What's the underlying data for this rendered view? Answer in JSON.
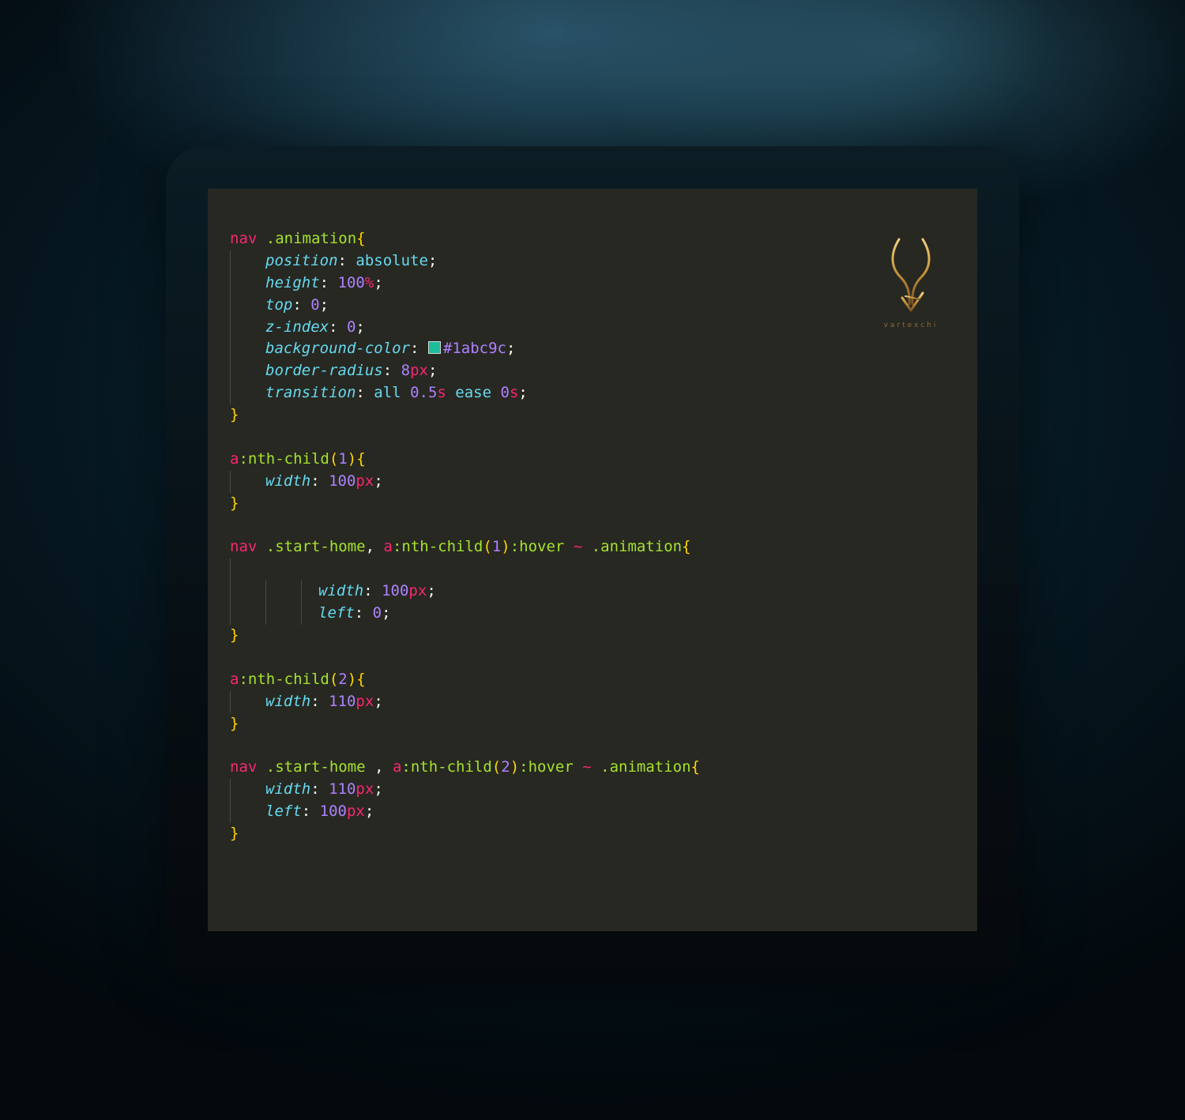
{
  "logo": {
    "icon": "gold-antler-logo",
    "caption": "vartexchi",
    "color": "#c8953c"
  },
  "swatch_color": "#1abc9c",
  "code_lines": [
    {
      "indent": 0,
      "guides": 0,
      "tokens": [
        [
          "tag",
          "nav"
        ],
        [
          "punc",
          " "
        ],
        [
          "cls",
          ".animation"
        ],
        [
          "brace",
          "{"
        ]
      ]
    },
    {
      "indent": 1,
      "guides": 1,
      "tokens": [
        [
          "prop",
          "position"
        ],
        [
          "punc",
          ": "
        ],
        [
          "kw",
          "absolute"
        ],
        [
          "punc",
          ";"
        ]
      ]
    },
    {
      "indent": 1,
      "guides": 1,
      "tokens": [
        [
          "prop",
          "height"
        ],
        [
          "punc",
          ": "
        ],
        [
          "num",
          "100"
        ],
        [
          "unit",
          "%"
        ],
        [
          "punc",
          ";"
        ]
      ]
    },
    {
      "indent": 1,
      "guides": 1,
      "tokens": [
        [
          "prop",
          "top"
        ],
        [
          "punc",
          ": "
        ],
        [
          "num",
          "0"
        ],
        [
          "punc",
          ";"
        ]
      ]
    },
    {
      "indent": 1,
      "guides": 1,
      "tokens": [
        [
          "prop",
          "z-index"
        ],
        [
          "punc",
          ": "
        ],
        [
          "num",
          "0"
        ],
        [
          "punc",
          ";"
        ]
      ]
    },
    {
      "indent": 1,
      "guides": 1,
      "tokens": [
        [
          "prop",
          "background-color"
        ],
        [
          "punc",
          ": "
        ],
        [
          "swatch",
          ""
        ],
        [
          "num",
          "#1abc9c"
        ],
        [
          "punc",
          ";"
        ]
      ]
    },
    {
      "indent": 1,
      "guides": 1,
      "tokens": [
        [
          "prop",
          "border-radius"
        ],
        [
          "punc",
          ": "
        ],
        [
          "num",
          "8"
        ],
        [
          "unit",
          "px"
        ],
        [
          "punc",
          ";"
        ]
      ]
    },
    {
      "indent": 1,
      "guides": 1,
      "tokens": [
        [
          "prop",
          "transition"
        ],
        [
          "punc",
          ": "
        ],
        [
          "kw",
          "all"
        ],
        [
          "punc",
          " "
        ],
        [
          "num",
          "0.5"
        ],
        [
          "unit",
          "s"
        ],
        [
          "punc",
          " "
        ],
        [
          "kw",
          "ease"
        ],
        [
          "punc",
          " "
        ],
        [
          "num",
          "0"
        ],
        [
          "unit",
          "s"
        ],
        [
          "punc",
          ";"
        ]
      ]
    },
    {
      "indent": 0,
      "guides": 0,
      "tokens": [
        [
          "brace",
          "}"
        ]
      ]
    },
    {
      "indent": 0,
      "guides": 0,
      "tokens": []
    },
    {
      "indent": 0,
      "guides": 0,
      "tokens": [
        [
          "tag",
          "a"
        ],
        [
          "cls",
          ":nth-child"
        ],
        [
          "brace",
          "("
        ],
        [
          "num",
          "1"
        ],
        [
          "brace",
          ")"
        ],
        [
          "brace",
          "{"
        ]
      ]
    },
    {
      "indent": 1,
      "guides": 1,
      "tokens": [
        [
          "prop",
          "width"
        ],
        [
          "punc",
          ": "
        ],
        [
          "num",
          "100"
        ],
        [
          "unit",
          "px"
        ],
        [
          "punc",
          ";"
        ]
      ]
    },
    {
      "indent": 0,
      "guides": 0,
      "tokens": [
        [
          "brace",
          "}"
        ]
      ]
    },
    {
      "indent": 0,
      "guides": 0,
      "tokens": []
    },
    {
      "indent": 0,
      "guides": 0,
      "tokens": [
        [
          "tag",
          "nav"
        ],
        [
          "punc",
          " "
        ],
        [
          "cls",
          ".start-home"
        ],
        [
          "punc",
          ", "
        ],
        [
          "tag",
          "a"
        ],
        [
          "cls",
          ":nth-child"
        ],
        [
          "brace",
          "("
        ],
        [
          "num",
          "1"
        ],
        [
          "brace",
          ")"
        ],
        [
          "cls",
          ":hover"
        ],
        [
          "punc",
          " "
        ],
        [
          "tilde",
          "~"
        ],
        [
          "punc",
          " "
        ],
        [
          "cls",
          ".animation"
        ],
        [
          "brace",
          "{"
        ]
      ]
    },
    {
      "indent": 0,
      "guides": 1,
      "tokens": []
    },
    {
      "indent": 3,
      "guides": 3,
      "tokens": [
        [
          "prop",
          "width"
        ],
        [
          "punc",
          ": "
        ],
        [
          "num",
          "100"
        ],
        [
          "unit",
          "px"
        ],
        [
          "punc",
          ";"
        ]
      ]
    },
    {
      "indent": 3,
      "guides": 3,
      "tokens": [
        [
          "prop",
          "left"
        ],
        [
          "punc",
          ": "
        ],
        [
          "num",
          "0"
        ],
        [
          "punc",
          ";"
        ]
      ]
    },
    {
      "indent": 0,
      "guides": 0,
      "tokens": [
        [
          "brace",
          "}"
        ]
      ]
    },
    {
      "indent": 0,
      "guides": 0,
      "tokens": []
    },
    {
      "indent": 0,
      "guides": 0,
      "tokens": [
        [
          "tag",
          "a"
        ],
        [
          "cls",
          ":nth-child"
        ],
        [
          "brace",
          "("
        ],
        [
          "num",
          "2"
        ],
        [
          "brace",
          ")"
        ],
        [
          "brace",
          "{"
        ]
      ]
    },
    {
      "indent": 1,
      "guides": 1,
      "tokens": [
        [
          "prop",
          "width"
        ],
        [
          "punc",
          ": "
        ],
        [
          "num",
          "110"
        ],
        [
          "unit",
          "px"
        ],
        [
          "punc",
          ";"
        ]
      ]
    },
    {
      "indent": 0,
      "guides": 0,
      "tokens": [
        [
          "brace",
          "}"
        ]
      ]
    },
    {
      "indent": 0,
      "guides": 0,
      "tokens": []
    },
    {
      "indent": 0,
      "guides": 0,
      "tokens": [
        [
          "tag",
          "nav"
        ],
        [
          "punc",
          " "
        ],
        [
          "cls",
          ".start-home"
        ],
        [
          "punc",
          " , "
        ],
        [
          "tag",
          "a"
        ],
        [
          "cls",
          ":nth-child"
        ],
        [
          "brace",
          "("
        ],
        [
          "num",
          "2"
        ],
        [
          "brace",
          ")"
        ],
        [
          "cls",
          ":hover"
        ],
        [
          "punc",
          " "
        ],
        [
          "tilde",
          "~"
        ],
        [
          "punc",
          " "
        ],
        [
          "cls",
          ".animation"
        ],
        [
          "brace",
          "{"
        ]
      ]
    },
    {
      "indent": 1,
      "guides": 1,
      "tokens": [
        [
          "prop",
          "width"
        ],
        [
          "punc",
          ": "
        ],
        [
          "num",
          "110"
        ],
        [
          "unit",
          "px"
        ],
        [
          "punc",
          ";"
        ]
      ]
    },
    {
      "indent": 1,
      "guides": 1,
      "tokens": [
        [
          "prop",
          "left"
        ],
        [
          "punc",
          ": "
        ],
        [
          "num",
          "100"
        ],
        [
          "unit",
          "px"
        ],
        [
          "punc",
          ";"
        ]
      ]
    },
    {
      "indent": 0,
      "guides": 0,
      "tokens": [
        [
          "brace",
          "}"
        ]
      ]
    }
  ]
}
